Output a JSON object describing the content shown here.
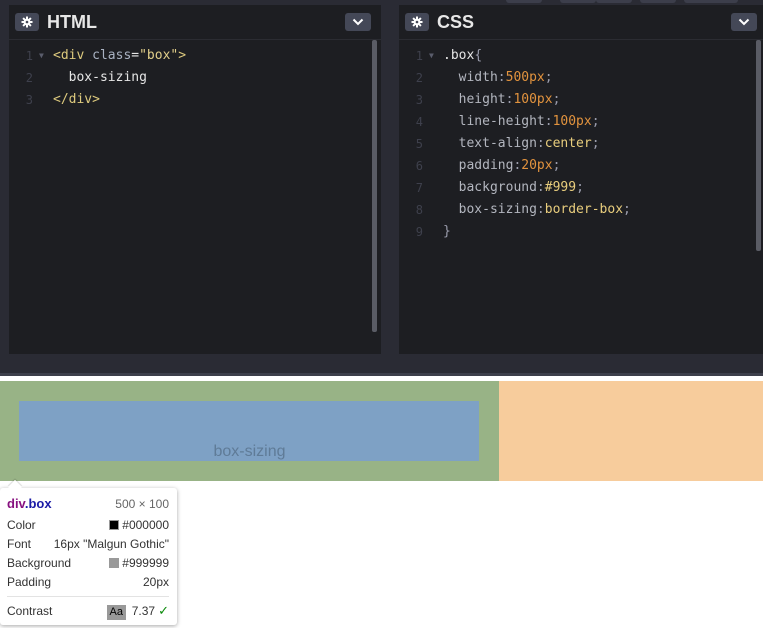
{
  "html_panel": {
    "title": "HTML",
    "lines": [
      {
        "n": "1",
        "fold": true,
        "tokens": [
          [
            "t-tag",
            "<div "
          ],
          [
            "t-attr",
            "class"
          ],
          [
            "t-plain",
            "="
          ],
          [
            "t-str",
            "\"box\""
          ],
          [
            "t-tag",
            ">"
          ]
        ]
      },
      {
        "n": "2",
        "fold": false,
        "tokens": [
          [
            "t-plain",
            "  box-sizing"
          ]
        ]
      },
      {
        "n": "3",
        "fold": false,
        "tokens": [
          [
            "t-tag",
            "</div>"
          ]
        ]
      }
    ]
  },
  "css_panel": {
    "title": "CSS",
    "lines": [
      {
        "n": "1",
        "fold": true,
        "tokens": [
          [
            "t-sel",
            ".box"
          ],
          [
            "t-punc",
            "{"
          ]
        ]
      },
      {
        "n": "2",
        "fold": false,
        "tokens": [
          [
            "t-prop",
            "  width"
          ],
          [
            "t-punc",
            ":"
          ],
          [
            "t-num",
            "500px"
          ],
          [
            "t-punc",
            ";"
          ]
        ]
      },
      {
        "n": "3",
        "fold": false,
        "tokens": [
          [
            "t-prop",
            "  height"
          ],
          [
            "t-punc",
            ":"
          ],
          [
            "t-num",
            "100px"
          ],
          [
            "t-punc",
            ";"
          ]
        ]
      },
      {
        "n": "4",
        "fold": false,
        "tokens": [
          [
            "t-prop",
            "  line-height"
          ],
          [
            "t-punc",
            ":"
          ],
          [
            "t-num",
            "100px"
          ],
          [
            "t-punc",
            ";"
          ]
        ]
      },
      {
        "n": "5",
        "fold": false,
        "tokens": [
          [
            "t-prop",
            "  text-align"
          ],
          [
            "t-punc",
            ":"
          ],
          [
            "t-val",
            "center"
          ],
          [
            "t-punc",
            ";"
          ]
        ]
      },
      {
        "n": "6",
        "fold": false,
        "tokens": [
          [
            "t-prop",
            "  padding"
          ],
          [
            "t-punc",
            ":"
          ],
          [
            "t-num",
            "20px"
          ],
          [
            "t-punc",
            ";"
          ]
        ]
      },
      {
        "n": "7",
        "fold": false,
        "tokens": [
          [
            "t-prop",
            "  background"
          ],
          [
            "t-punc",
            ":"
          ],
          [
            "t-val",
            "#999"
          ],
          [
            "t-punc",
            ";"
          ]
        ]
      },
      {
        "n": "8",
        "fold": false,
        "tokens": [
          [
            "t-prop",
            "  box-sizing"
          ],
          [
            "t-punc",
            ":"
          ],
          [
            "t-val",
            "border-box"
          ],
          [
            "t-punc",
            ";"
          ]
        ]
      },
      {
        "n": "9",
        "fold": false,
        "tokens": [
          [
            "t-punc",
            "}"
          ]
        ]
      }
    ]
  },
  "preview": {
    "box_text": "box-sizing"
  },
  "inspector_tooltip": {
    "tag": "div",
    "class": ".box",
    "size": "500 × 100",
    "color_label": "Color",
    "color_value": "#000000",
    "color_swatch": "#000000",
    "font_label": "Font",
    "font_value": "16px \"Malgun Gothic\"",
    "background_label": "Background",
    "background_value": "#999999",
    "background_swatch": "#999999",
    "padding_label": "Padding",
    "padding_value": "20px",
    "contrast_label": "Contrast",
    "contrast_badge": "Aa",
    "contrast_value": "7.37",
    "contrast_check": "✓"
  }
}
